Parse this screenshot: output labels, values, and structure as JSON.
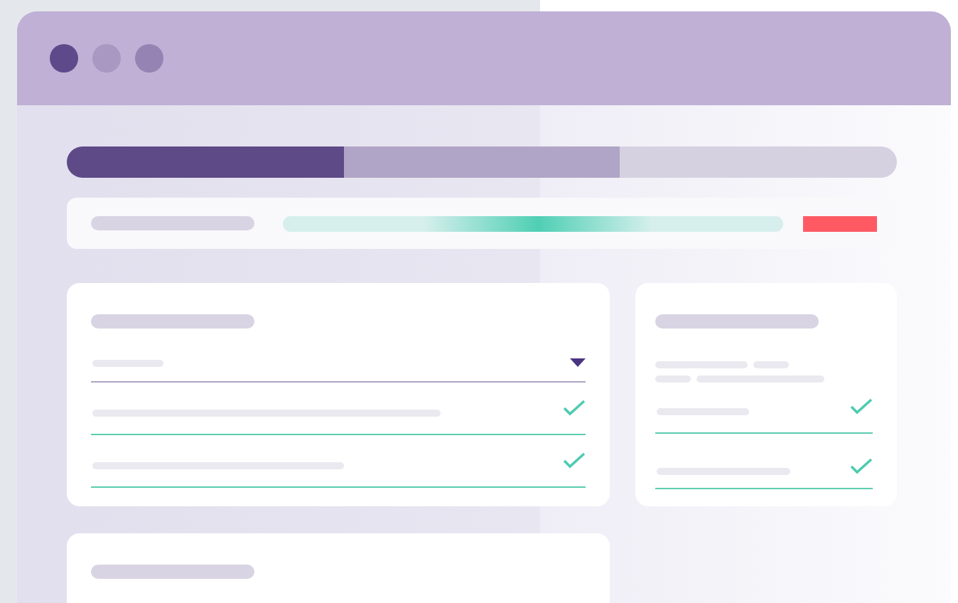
{
  "window": {
    "controls": [
      {
        "kind": "close"
      },
      {
        "kind": "minimize"
      },
      {
        "kind": "maximize"
      }
    ]
  },
  "steps": [
    {
      "completed": true
    },
    {
      "completed": false
    },
    {
      "completed": false
    }
  ],
  "search": {
    "level": 0.51,
    "alert": true
  },
  "form": {
    "fields": [
      {
        "kind": "select",
        "checked": false
      },
      {
        "kind": "text",
        "checked": true
      },
      {
        "kind": "text",
        "checked": true
      }
    ]
  },
  "side": {
    "fields": [
      {
        "checked": true
      },
      {
        "checked": true
      }
    ]
  },
  "lower_card": {
    "kind": "card"
  }
}
